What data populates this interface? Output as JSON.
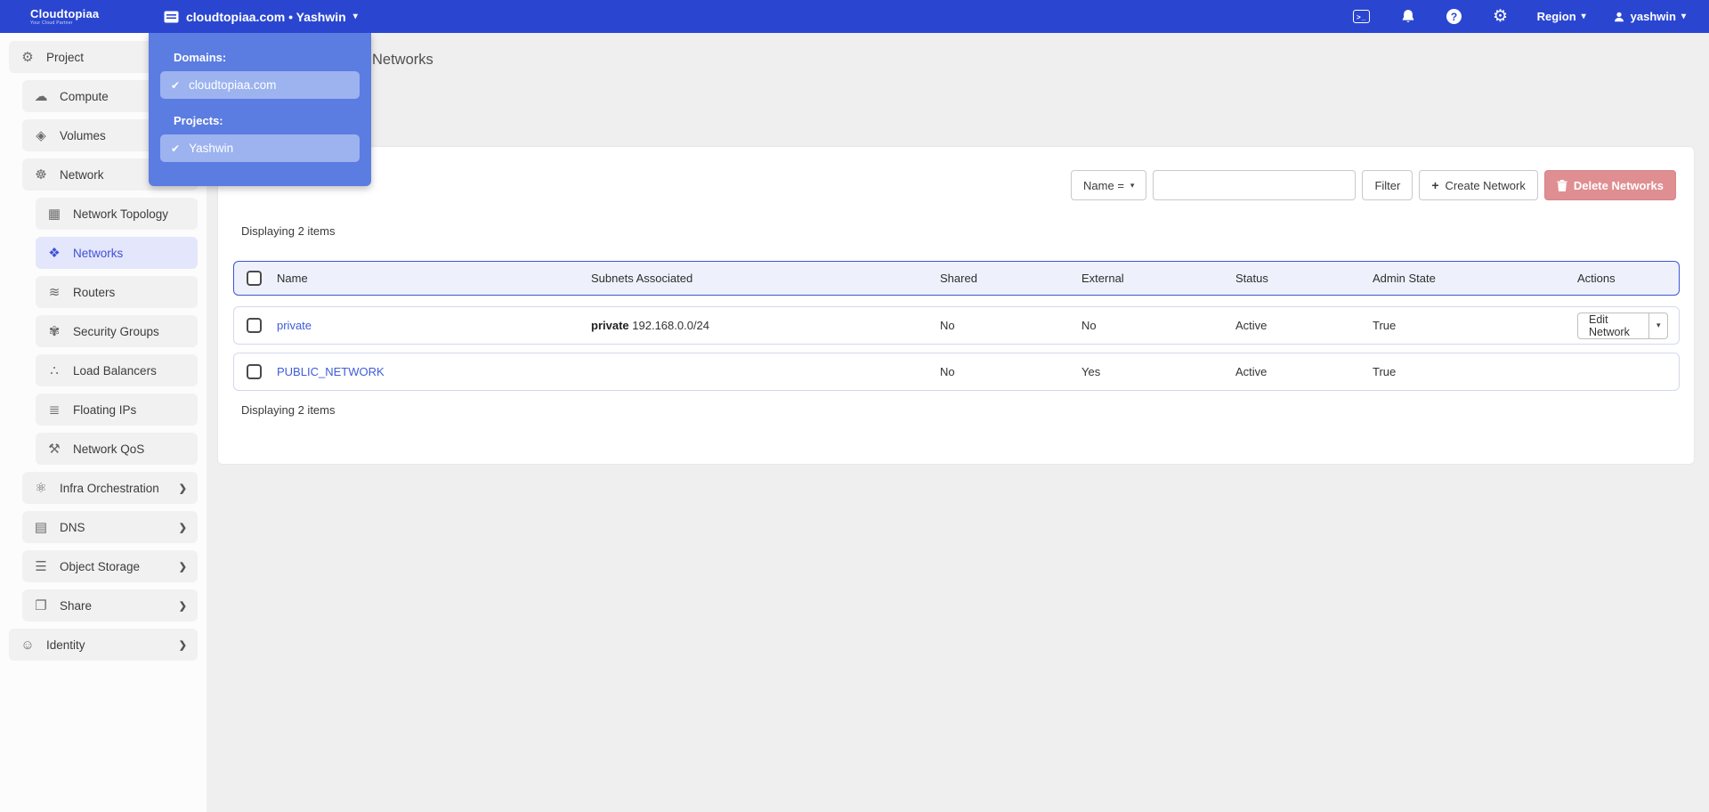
{
  "navbar": {
    "brand": {
      "name": "Cloudtopiaa",
      "tagline": "Your Cloud Partner"
    },
    "context_switcher": {
      "label": "cloudtopiaa.com • Yashwin"
    },
    "region_label": "Region",
    "username": "yashwin",
    "icons": [
      "terminal-icon",
      "bell-icon",
      "help-icon",
      "gear-icon"
    ]
  },
  "context_dropdown": {
    "domains_heading": "Domains:",
    "domains": [
      {
        "label": "cloudtopiaa.com",
        "checked": true
      }
    ],
    "projects_heading": "Projects:",
    "projects": [
      {
        "label": "Yashwin",
        "checked": true
      }
    ]
  },
  "sidebar": {
    "items": [
      {
        "label": "Project",
        "level": 0,
        "icon": "project-gear-icon"
      },
      {
        "label": "Compute",
        "level": 1,
        "icon": "cloud-icon"
      },
      {
        "label": "Volumes",
        "level": 1,
        "icon": "volume-cube-icon"
      },
      {
        "label": "Network",
        "level": 1,
        "icon": "network-nodes-icon"
      },
      {
        "label": "Network Topology",
        "level": 2,
        "icon": "topology-icon"
      },
      {
        "label": "Networks",
        "level": 2,
        "icon": "networks-icon",
        "active": true
      },
      {
        "label": "Routers",
        "level": 2,
        "icon": "router-icon"
      },
      {
        "label": "Security Groups",
        "level": 2,
        "icon": "security-icon"
      },
      {
        "label": "Load Balancers",
        "level": 2,
        "icon": "load-balancer-icon"
      },
      {
        "label": "Floating IPs",
        "level": 2,
        "icon": "floating-ip-icon"
      },
      {
        "label": "Network QoS",
        "level": 2,
        "icon": "qos-icon"
      },
      {
        "label": "Infra Orchestration",
        "level": 1,
        "icon": "orchestration-icon",
        "chevron": true
      },
      {
        "label": "DNS",
        "level": 1,
        "icon": "dns-server-icon",
        "chevron": true
      },
      {
        "label": "Object Storage",
        "level": 1,
        "icon": "object-storage-icon",
        "chevron": true
      },
      {
        "label": "Share",
        "level": 1,
        "icon": "share-file-icon",
        "chevron": true
      },
      {
        "label": "Identity",
        "level": 0,
        "icon": "identity-icon",
        "chevron": true
      }
    ]
  },
  "page": {
    "title": "Networks"
  },
  "toolbar": {
    "filter_field_label": "Name =",
    "search_value": "",
    "filter_button_label": "Filter",
    "create_button_label": "Create Network",
    "delete_button_label": "Delete Networks"
  },
  "table": {
    "count_top": "Displaying 2 items",
    "count_bottom": "Displaying 2 items",
    "columns": [
      "Name",
      "Subnets Associated",
      "Shared",
      "External",
      "Status",
      "Admin State",
      "Actions"
    ],
    "rows": [
      {
        "name": "private",
        "subnet_name": "private",
        "subnet_cidr": "192.168.0.0/24",
        "shared": "No",
        "external": "No",
        "status": "Active",
        "admin_state": "True",
        "action_label": "Edit Network"
      },
      {
        "name": "PUBLIC_NETWORK",
        "subnet_name": "",
        "subnet_cidr": "",
        "shared": "No",
        "external": "Yes",
        "status": "Active",
        "admin_state": "True",
        "action_label": ""
      }
    ]
  },
  "colors": {
    "navbar": "#2a46d0",
    "dropdown_panel": "#5b7ce1",
    "dropdown_item": "#9cb3f0",
    "active_item_bg": "#e4e7fb",
    "accent_blue": "#3f56d3",
    "delete_red": "#df8e92",
    "link_blue": "#3f5bd9"
  }
}
